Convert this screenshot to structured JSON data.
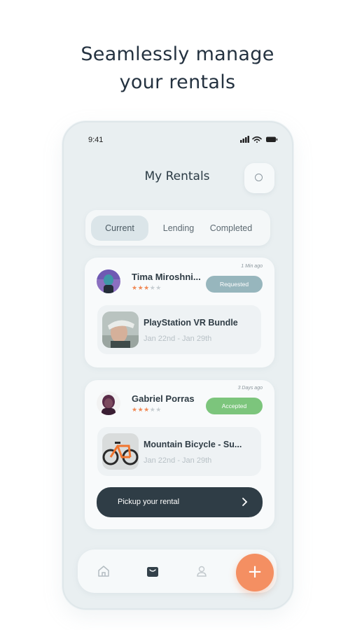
{
  "headline": {
    "line1": "Seamlessly manage",
    "line2": "your rentals"
  },
  "status_bar": {
    "time": "9:41"
  },
  "header": {
    "title": "My Rentals"
  },
  "tabs": [
    {
      "label": "Current",
      "active": true
    },
    {
      "label": "Lending",
      "active": false
    },
    {
      "label": "Completed",
      "active": false
    }
  ],
  "rentals": [
    {
      "user": "Tima Miroshni...",
      "rating": 3,
      "rating_max": 5,
      "time_ago": "1 Min ago",
      "status": "Requested",
      "status_color": "#97b6bd",
      "item": "PlayStation VR Bundle",
      "dates": "Jan 22nd - Jan 29th"
    },
    {
      "user": "Gabriel Porras",
      "rating": 3,
      "rating_max": 5,
      "time_ago": "3 Days ago",
      "status": "Accepted",
      "status_color": "#7cc57c",
      "item": "Mountain Bicycle - Su...",
      "dates": "Jan 22nd - Jan 29th",
      "action": "Pickup your rental"
    }
  ],
  "nav": [
    {
      "icon": "home-icon"
    },
    {
      "icon": "bag-icon",
      "active": true
    },
    {
      "icon": "profile-icon"
    },
    {
      "icon": "plus-icon"
    }
  ],
  "colors": {
    "accent": "#f48f62",
    "dark": "#2f3d46",
    "background": "#e9eff1"
  }
}
